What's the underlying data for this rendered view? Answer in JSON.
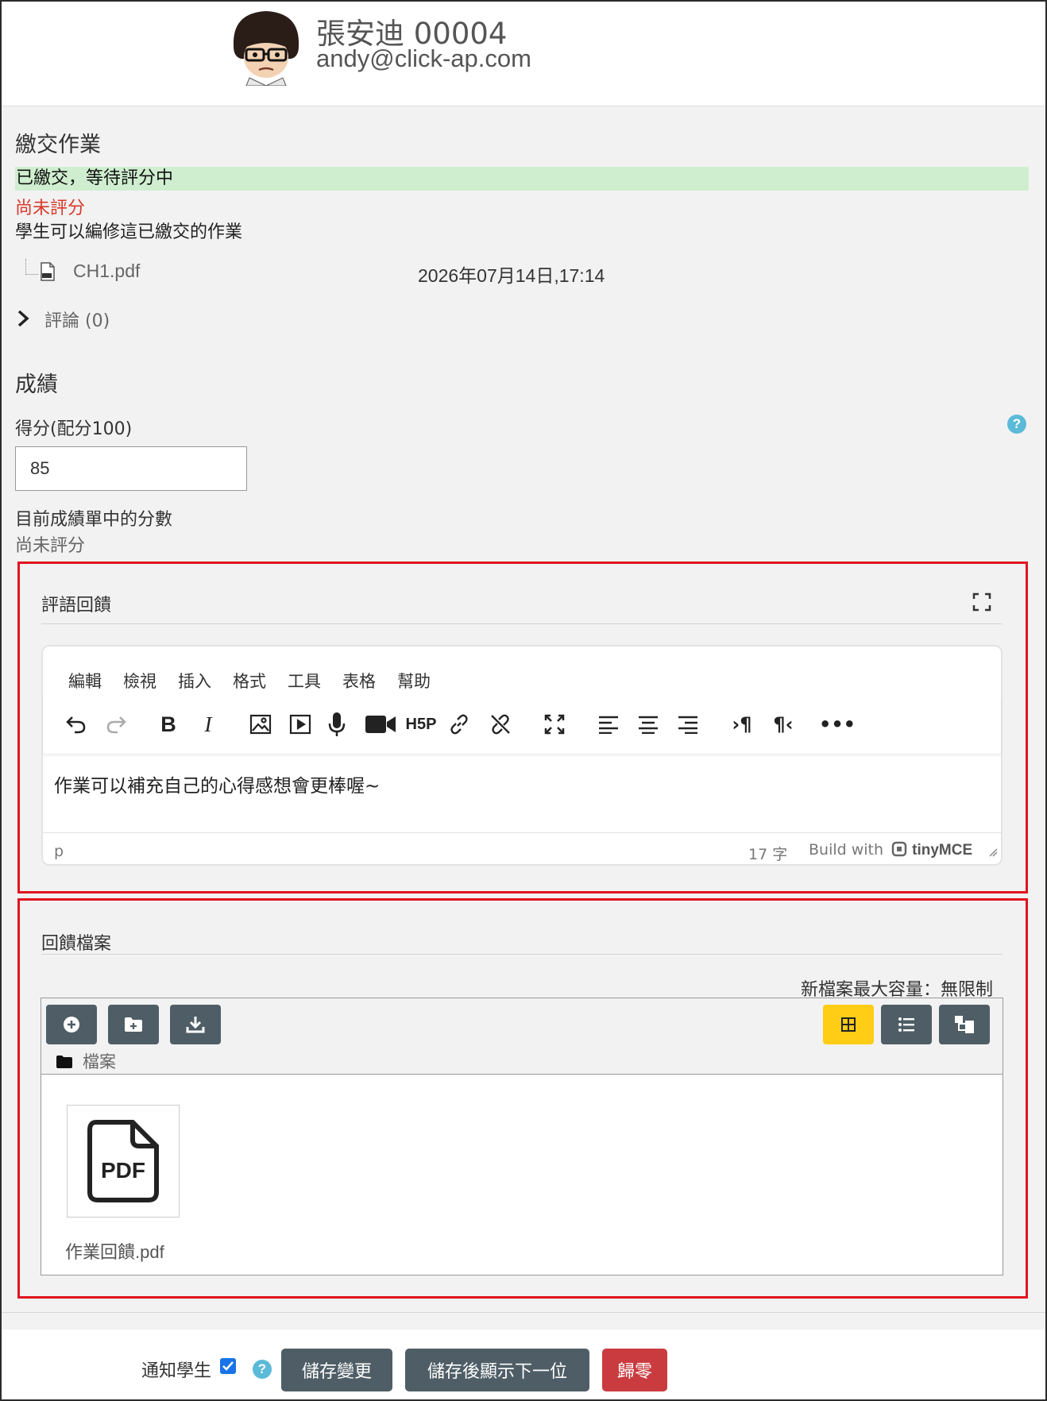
{
  "user": {
    "name": "張安迪 00004",
    "email": "andy@click-ap.com"
  },
  "submission": {
    "title": "繳交作業",
    "status": "已繳交，等待評分中",
    "grading_status": "尚未評分",
    "edit_note": "學生可以編修這已繳交的作業",
    "file_name": "CH1.pdf",
    "file_date": "2026年07月14日,17:14",
    "comments_label": "評論 (0)"
  },
  "grade": {
    "title": "成績",
    "score_label": "得分(配分100)",
    "score_value": "85",
    "current_label": "目前成績單中的分數",
    "current_value": "尚未評分"
  },
  "feedback": {
    "title": "評語回饋",
    "menu": [
      "編輯",
      "檢視",
      "插入",
      "格式",
      "工具",
      "表格",
      "幫助"
    ],
    "content": "作業可以補充自己的心得感想會更棒喔~",
    "path": "p",
    "word_count": "17 字",
    "brand_prefix": "Build with",
    "brand_name": "tinyMCE"
  },
  "feedback_files": {
    "title": "回饋檔案",
    "max_size": "新檔案最大容量：無限制",
    "folder": "檔案",
    "file_name": "作業回饋.pdf",
    "thumb_label": "PDF"
  },
  "footer": {
    "notify_label": "通知學生",
    "save_label": "儲存變更",
    "save_next_label": "儲存後顯示下一位",
    "reset_label": "歸零"
  },
  "colors": {
    "status_bg": "#cfeecf",
    "red_text": "#d9382a",
    "highlight_border": "#e0141e",
    "button_dark": "#4f5e66",
    "button_active": "#ffcc16",
    "button_danger": "#ca3b3f",
    "help": "#5bbad8"
  }
}
